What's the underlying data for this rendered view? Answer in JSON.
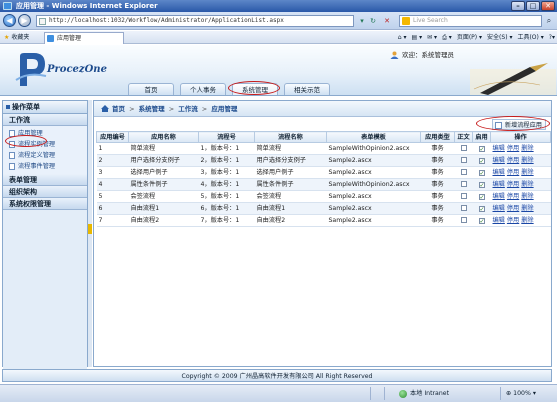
{
  "window": {
    "title": "应用管理 - Windows Internet Explorer",
    "controls": {
      "minimize": "–",
      "maximize": "□",
      "close": "✕"
    }
  },
  "browser": {
    "back_glyph": "◀",
    "forward_glyph": "▶",
    "url": "http://localhost:1032/Workflow/Administrator/ApplicationList.aspx",
    "refresh_glyph": "↻",
    "stop_glyph": "✕",
    "search_placeholder": "Live Search",
    "search_glyph": "⌕",
    "favorites_label": "收藏夹",
    "tab_label": "应用管理",
    "command_items": [
      "⌂ ▾",
      "▤ ▾",
      "✉ ▾",
      "⎙ ▾",
      "页面(P) ▾",
      "安全(S) ▾",
      "工具(O) ▾",
      "?▾"
    ]
  },
  "app": {
    "logo_text": "ProcezOne",
    "welcome_text": "欢迎：系统管理员",
    "top_nav": [
      {
        "label": "首页"
      },
      {
        "label": "个人事务"
      },
      {
        "label": "系统管理"
      },
      {
        "label": "相关示范"
      }
    ]
  },
  "sidebar": {
    "header": "操作菜单",
    "sections": [
      {
        "label": "工作流",
        "items": [
          {
            "label": "应用管理"
          },
          {
            "label": "流程实例管理"
          },
          {
            "label": "流程定义管理"
          },
          {
            "label": "流程事件管理"
          }
        ]
      },
      {
        "label": "表单管理"
      },
      {
        "label": "组织架构"
      },
      {
        "label": "系统权限管理"
      }
    ]
  },
  "breadcrumb": {
    "items": [
      "首页",
      "系统管理",
      "工作流",
      "应用管理"
    ],
    "separator": ">"
  },
  "toolbar": {
    "add_label": "新增流程应用"
  },
  "table": {
    "headers": [
      "应用编号",
      "应用名称",
      "流程号",
      "流程名称",
      "表单模板",
      "应用类型",
      "正文",
      "启用",
      "操作"
    ],
    "rows": [
      {
        "id": "1",
        "name": "简单流程",
        "flow_no": "1，版本号：1",
        "flow_name": "简单流程",
        "form": "SampleWithOpinion2.ascx",
        "type": "事务",
        "body": false,
        "enabled": true
      },
      {
        "id": "2",
        "name": "用户选择分支例子",
        "flow_no": "2，版本号：1",
        "flow_name": "用户选择分支例子",
        "form": "Sample2.ascx",
        "type": "事务",
        "body": false,
        "enabled": true
      },
      {
        "id": "3",
        "name": "选择用户例子",
        "flow_no": "3，版本号：1",
        "flow_name": "选择用户例子",
        "form": "Sample2.ascx",
        "type": "事务",
        "body": false,
        "enabled": true
      },
      {
        "id": "4",
        "name": "属性条件例子",
        "flow_no": "4，版本号：1",
        "flow_name": "属性条件例子",
        "form": "SampleWithOpinion2.ascx",
        "type": "事务",
        "body": false,
        "enabled": true
      },
      {
        "id": "5",
        "name": "会签流程",
        "flow_no": "5，版本号：1",
        "flow_name": "会签流程",
        "form": "Sample2.ascx",
        "type": "事务",
        "body": false,
        "enabled": true
      },
      {
        "id": "6",
        "name": "自由流程1",
        "flow_no": "6，版本号：1",
        "flow_name": "自由流程1",
        "form": "Sample2.ascx",
        "type": "事务",
        "body": false,
        "enabled": true
      },
      {
        "id": "7",
        "name": "自由流程2",
        "flow_no": "7，版本号：1",
        "flow_name": "自由流程2",
        "form": "Sample2.ascx",
        "type": "事务",
        "body": false,
        "enabled": true
      }
    ],
    "row_actions": [
      "编辑",
      "停用",
      "删除"
    ]
  },
  "footer": {
    "text": "Copyright © 2009 广州晶高软件开发有限公司 All Right Reserved"
  },
  "statusbar": {
    "left_text": "",
    "zone_text": "本地 Intranet",
    "zoom_text": "100%"
  }
}
